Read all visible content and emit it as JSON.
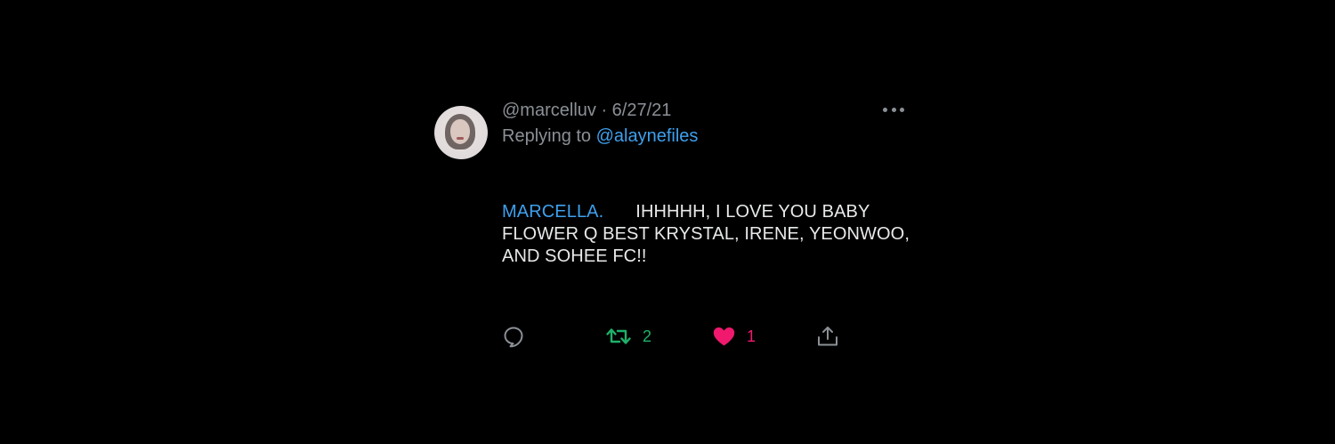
{
  "tweet": {
    "handle": "@marcelluv",
    "separator": " · ",
    "date": "6/27/21",
    "replying_prefix": "Replying to ",
    "replying_to": "@alaynefiles",
    "body_name": "MARCELLA.",
    "body_text": "IHHHHH, I LOVE YOU BABY FLOWER Q BEST KRYSTAL, IRENE, YEONWOO, AND SOHEE FC!!"
  },
  "actions": {
    "reply_icon": "reply-icon",
    "retweet_icon": "retweet-icon",
    "retweet_count": "2",
    "like_icon": "heart-icon",
    "like_count": "1",
    "share_icon": "share-icon"
  },
  "colors": {
    "background": "#000000",
    "muted": "#8b9096",
    "link": "#3ea0ee",
    "retweet": "#1db26a",
    "like": "#f0196e",
    "text": "#e7e9ea"
  }
}
